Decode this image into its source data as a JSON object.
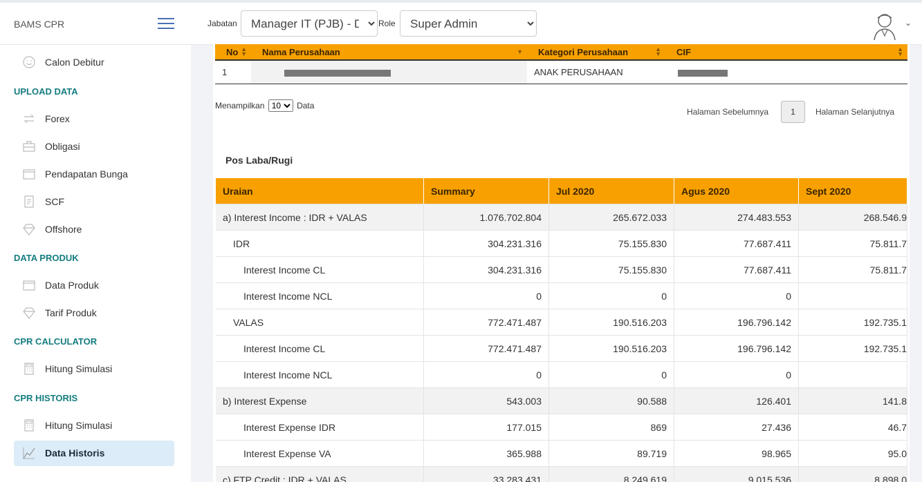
{
  "header": {
    "brand": "BAMS CPR",
    "jabatan_label": "Jabatan",
    "jabatan_value": "Manager IT (PJB) - Divisi",
    "role_label": "Role",
    "role_value": "Super Admin"
  },
  "sidebar": {
    "items": [
      {
        "label": "Calon Debitur",
        "icon": "smile-icon"
      },
      {
        "label": "Forex",
        "icon": "exchange-icon"
      },
      {
        "label": "Obligasi",
        "icon": "briefcase-icon"
      },
      {
        "label": "Pendapatan Bunga",
        "icon": "wallet-icon"
      },
      {
        "label": "SCF",
        "icon": "document-icon"
      },
      {
        "label": "Offshore",
        "icon": "diamond-icon"
      },
      {
        "label": "Data Produk",
        "icon": "wallet-icon"
      },
      {
        "label": "Tarif Produk",
        "icon": "diamond-icon"
      },
      {
        "label": "Hitung Simulasi",
        "icon": "calculator-icon"
      },
      {
        "label": "Hitung Simulasi",
        "icon": "calculator-icon"
      },
      {
        "label": "Data Historis",
        "icon": "line-chart-icon"
      }
    ],
    "sections": {
      "upload": "UPLOAD DATA",
      "produk": "DATA PRODUK",
      "calc": "CPR CALCULATOR",
      "hist": "CPR HISTORIS"
    }
  },
  "company_table": {
    "headers": [
      "No",
      "Nama Perusahaan",
      "Kategori Perusahaan",
      "CIF"
    ],
    "row": {
      "no": "1",
      "kategori": "ANAK PERUSAHAAN"
    }
  },
  "pagination": {
    "show_prefix": "Menampilkan",
    "page_size": "10",
    "show_suffix": "Data",
    "prev": "Halaman Sebelumnya",
    "page": "1",
    "next": "Halaman Selanjutnya"
  },
  "laba_rugi": {
    "title": "Pos Laba/Rugi",
    "headers": [
      "Uraian",
      "Summary",
      "Jul 2020",
      "Agus 2020",
      "Sept 2020"
    ],
    "rows": [
      [
        "a) Interest Income : IDR + VALAS",
        "1.076.702.804",
        "265.672.033",
        "274.483.553",
        "268.546.9"
      ],
      [
        "IDR",
        "304.231.316",
        "75.155.830",
        "77.687.411",
        "75.811.7"
      ],
      [
        "Interest Income CL",
        "304.231.316",
        "75.155.830",
        "77.687.411",
        "75.811.7"
      ],
      [
        "Interest Income NCL",
        "0",
        "0",
        "0",
        ""
      ],
      [
        "VALAS",
        "772.471.487",
        "190.516.203",
        "196.796.142",
        "192.735.1"
      ],
      [
        "Interest Income CL",
        "772.471.487",
        "190.516.203",
        "196.796.142",
        "192.735.1"
      ],
      [
        "Interest Income NCL",
        "0",
        "0",
        "0",
        ""
      ],
      [
        "b) Interest Expense",
        "543.003",
        "90.588",
        "126.401",
        "141.8"
      ],
      [
        "Interest Expense IDR",
        "177.015",
        "869",
        "27.436",
        "46.7"
      ],
      [
        "Interest Expense VA",
        "365.988",
        "89.719",
        "98.965",
        "95.0"
      ],
      [
        "c) FTP Credit : IDR + VALAS",
        "33.283.431",
        "8.249.619",
        "9.015.536",
        "8.898.0"
      ]
    ]
  }
}
